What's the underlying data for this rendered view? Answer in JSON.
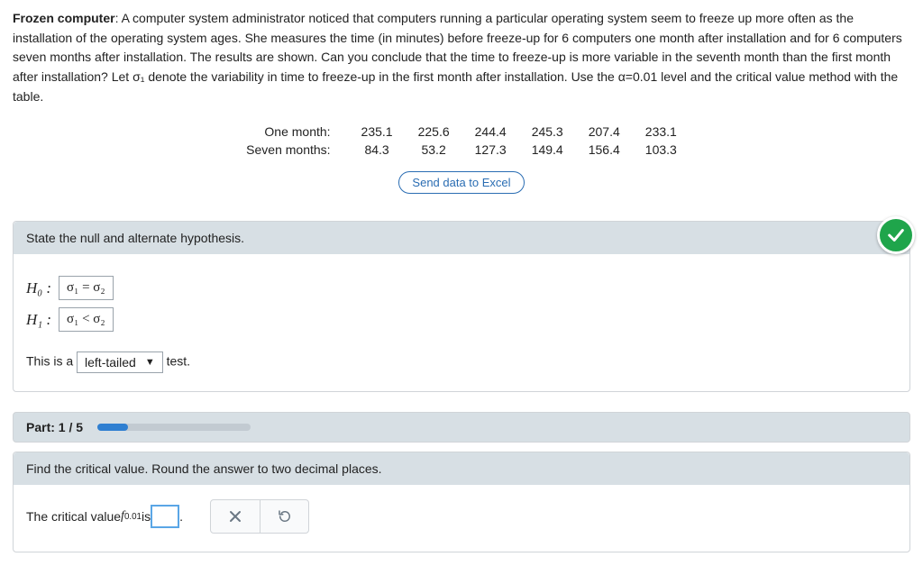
{
  "problem": {
    "title": "Frozen computer",
    "body_html": ": A computer system administrator noticed that computers running a particular operating system seem to freeze up more often as the installation of the operating system ages. She measures the time (in minutes) before freeze-up for 6 computers one month after installation and for 6 computers seven months after installation. The results are shown. Can you conclude that the time to freeze-up is more variable in the seventh month than the first month after installation? Let σ₁ denote the variability in time to freeze-up in the first month after installation. Use the α=0.01 level and the critical value method with the table."
  },
  "data_rows": {
    "row1_label": "One month:",
    "row1_values": [
      "235.1",
      "225.6",
      "244.4",
      "245.3",
      "207.4",
      "233.1"
    ],
    "row2_label": "Seven months:",
    "row2_values": [
      "84.3",
      "53.2",
      "127.3",
      "149.4",
      "156.4",
      "103.3"
    ]
  },
  "buttons": {
    "excel": "Send data to Excel"
  },
  "panel1": {
    "header": "State the null and alternate hypothesis.",
    "h0_label": "H₀ :",
    "h0_value": "σ₁ = σ₂",
    "h1_label": "H₁ :",
    "h1_value": "σ₁ < σ₂",
    "tail_prefix": "This is a ",
    "tail_value": "left-tailed",
    "tail_suffix": " test."
  },
  "part_bar": {
    "label": "Part: 1 / 5",
    "progress_pct": 20
  },
  "panel2": {
    "header": "Find the critical value. Round the answer to two decimal places.",
    "sentence_prefix": "The critical value ",
    "f_symbol": "f",
    "f_sub": "0.01",
    "sentence_mid": " is ",
    "sentence_suffix": " ."
  }
}
